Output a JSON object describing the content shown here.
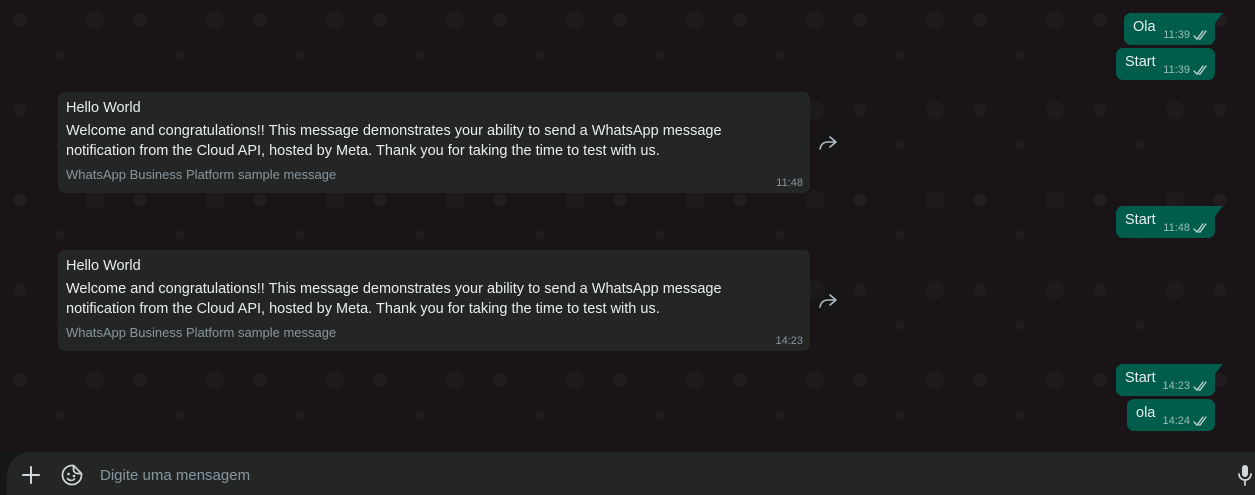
{
  "outgoing": [
    {
      "text": "Ola",
      "time": "11:39"
    },
    {
      "text": "Start",
      "time": "11:39"
    },
    {
      "text": "Start",
      "time": "11:48"
    },
    {
      "text": "Start",
      "time": "14:23"
    },
    {
      "text": "ola",
      "time": "14:24"
    }
  ],
  "incoming": [
    {
      "title": "Hello World",
      "body": "Welcome and congratulations!! This message demonstrates your ability to send a WhatsApp message notification from the Cloud API, hosted by Meta. Thank you for taking the time to test with us.",
      "footer": "WhatsApp Business Platform sample message",
      "time": "11:48"
    },
    {
      "title": "Hello World",
      "body": "Welcome and congratulations!! This message demonstrates your ability to send a WhatsApp message notification from the Cloud API, hosted by Meta. Thank you for taking the time to test with us.",
      "footer": "WhatsApp Business Platform sample message",
      "time": "14:23"
    }
  ],
  "composer": {
    "placeholder": "Digite uma mensagem",
    "value": ""
  },
  "icons": {
    "attach": "plus-icon",
    "sticker": "sticker-icon",
    "mic": "microphone-icon",
    "forward": "forward-icon",
    "read_receipt": "double-check-icon"
  },
  "colors": {
    "outgoing_bubble": "#005c4b",
    "incoming_bubble": "#242626",
    "accent": "#00a884",
    "read_ticks": "#e9edef"
  }
}
